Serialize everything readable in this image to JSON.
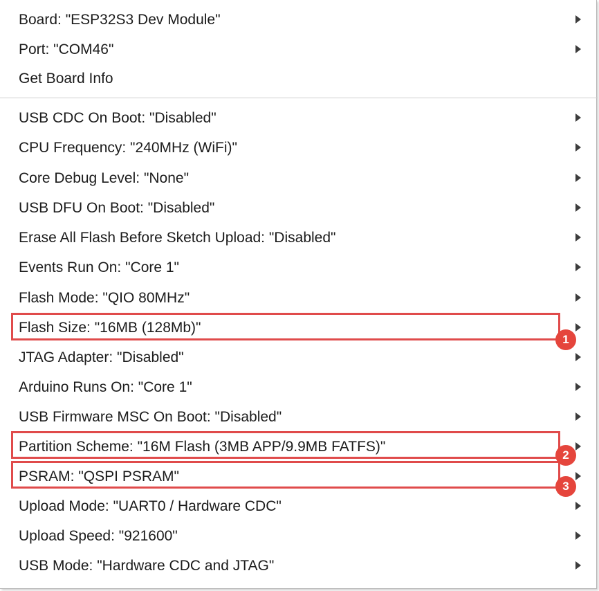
{
  "menu": {
    "top_items": [
      {
        "label": "Board: \"ESP32S3 Dev Module\"",
        "submenu": true
      },
      {
        "label": "Port: \"COM46\"",
        "submenu": true
      },
      {
        "label": "Get Board Info",
        "submenu": false
      }
    ],
    "settings_items": [
      {
        "label": "USB CDC On Boot: \"Disabled\"",
        "submenu": true
      },
      {
        "label": "CPU Frequency: \"240MHz (WiFi)\"",
        "submenu": true
      },
      {
        "label": "Core Debug Level: \"None\"",
        "submenu": true
      },
      {
        "label": "USB DFU On Boot: \"Disabled\"",
        "submenu": true
      },
      {
        "label": "Erase All Flash Before Sketch Upload: \"Disabled\"",
        "submenu": true
      },
      {
        "label": "Events Run On: \"Core 1\"",
        "submenu": true
      },
      {
        "label": "Flash Mode: \"QIO 80MHz\"",
        "submenu": true
      },
      {
        "label": "Flash Size: \"16MB (128Mb)\"",
        "submenu": true
      },
      {
        "label": "JTAG Adapter: \"Disabled\"",
        "submenu": true
      },
      {
        "label": "Arduino Runs On: \"Core 1\"",
        "submenu": true
      },
      {
        "label": "USB Firmware MSC On Boot: \"Disabled\"",
        "submenu": true
      },
      {
        "label": "Partition Scheme: \"16M Flash (3MB APP/9.9MB FATFS)\"",
        "submenu": true
      },
      {
        "label": "PSRAM: \"QSPI PSRAM\"",
        "submenu": true
      },
      {
        "label": "Upload Mode: \"UART0 / Hardware CDC\"",
        "submenu": true
      },
      {
        "label": "Upload Speed: \"921600\"",
        "submenu": true
      },
      {
        "label": "USB Mode: \"Hardware CDC and JTAG\"",
        "submenu": true
      }
    ]
  },
  "annotations": {
    "badges": [
      "1",
      "2",
      "3"
    ],
    "highlight_color": "#e04b4b"
  }
}
